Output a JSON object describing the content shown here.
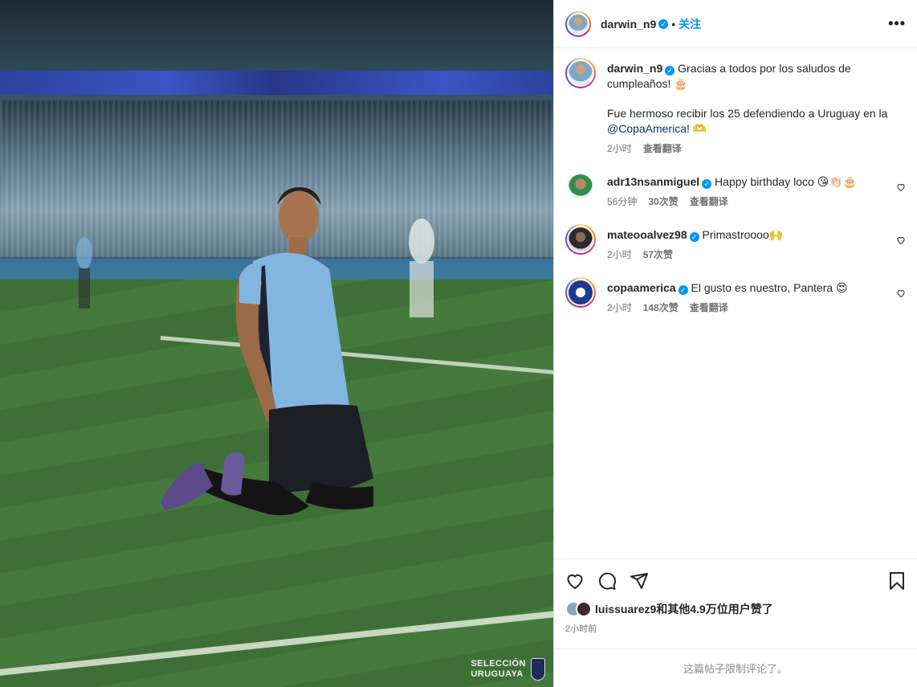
{
  "post": {
    "author": "darwin_n9",
    "verified_icon": "verified-badge-icon",
    "dot": "•",
    "follow_label": "关注",
    "more_label": "•••",
    "caption_line1": "Gracias a todos por los saludos de cumpleaños! 🎂",
    "caption_line2_pre": "Fue hermoso recibir los 25 defendiendo a Uruguay en la ",
    "caption_mention": "@CopaAmerica",
    "caption_line2_post": "! 🫶",
    "caption_time": "2小时",
    "caption_translate": "查看翻译"
  },
  "comments": [
    {
      "user": "adr13nsanmiguel",
      "text": "Happy birthday loco 😘👏🏻🎂",
      "time": "56分钟",
      "likes": "30次赞",
      "translate": "查看翻译"
    },
    {
      "user": "mateooalvez98",
      "text": "Primastroooo🙌",
      "time": "2小时",
      "likes": "57次赞",
      "translate": ""
    },
    {
      "user": "copaamerica",
      "text": "El gusto es nuestro, Pantera 😍",
      "time": "2小时",
      "likes": "148次赞",
      "translate": "查看翻译"
    }
  ],
  "footer": {
    "likes_text": "luissuarez9和其他4.9万位用户赞了",
    "time": "2小时前",
    "limited": "这篇帖子限制评论了。"
  },
  "watermark": {
    "line1": "SELECCIÓN",
    "line2": "URUGUAYA"
  },
  "colors": {
    "accent": "#0095f6",
    "link": "#00376b",
    "muted": "#737373"
  }
}
